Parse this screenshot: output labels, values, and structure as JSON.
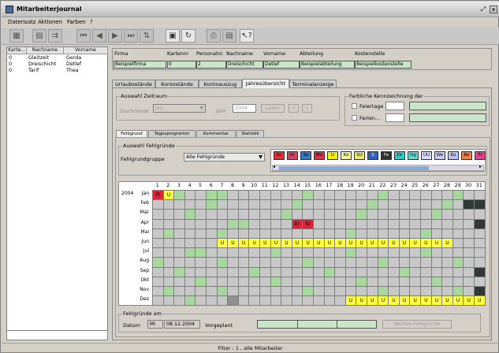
{
  "app": {
    "title": "Mitarbeiterjournal"
  },
  "menu": [
    "Datensatz",
    "Aktionen",
    "Farben",
    "?"
  ],
  "toolbar": {
    "icons": [
      "table-icon",
      "save-icon",
      "copy-icon",
      "first-record-icon",
      "previous-record-icon",
      "next-record-icon",
      "last-record-icon",
      "sort-icon",
      "disk-icon",
      "undo-icon",
      "print-icon",
      "print-preview-icon",
      "help-icon"
    ]
  },
  "left": {
    "headers": [
      "Karte...",
      "Nachname",
      "Vorname"
    ],
    "rows": [
      [
        "0",
        "Gleitzeit",
        "Gerda"
      ],
      [
        "0",
        "Dreischicht",
        "Detlef"
      ],
      [
        "0",
        "Tarif",
        "Thea"
      ]
    ]
  },
  "form": {
    "headers": [
      "Firma",
      "Kartennr",
      "Personalnr.",
      "Nachname",
      "Vorname",
      "Abteilung",
      "Kostenstelle"
    ],
    "values": [
      "Beispielfirma",
      "0",
      "2",
      "Dreischicht",
      "Detlef",
      "Beispielabteilung",
      "Beispielkostenstelle"
    ]
  },
  "tabs": [
    "Urlaubsstände",
    "Kontostände",
    "Kontoauszug",
    "Jahresübersicht",
    "Terminalanzeige"
  ],
  "zeitraum": {
    "legend": "Auswahl Zeitraum",
    "startmonat_label": "Startmonat",
    "startmonat_value": "Jan",
    "jahr_label": "Jahr",
    "jahr_value": "2004",
    "laden": "Laden",
    "prev": "<",
    "next": ">"
  },
  "farblich": {
    "legend": "Farbliche Kennzeichnung der",
    "feiertage": "Feiertage",
    "ferien": "Ferien..."
  },
  "subtabs": [
    "Fehlgrund",
    "Tagesprogramm",
    "Kommentar",
    "Statistik"
  ],
  "fehlgruende": {
    "legend": "Auswahl Fehlgründe",
    "gruppe_label": "Fehlgrundgruppe",
    "gruppe_value": "Alle Fehlgründe",
    "codes": [
      {
        "t": "Kr",
        "bg": "#e0303a",
        "fg": "#000"
      },
      {
        "t": "Kr",
        "bg": "#d84060",
        "fg": "#000"
      },
      {
        "t": "Se",
        "bg": "#3878c8",
        "fg": "#000"
      },
      {
        "t": "Mü",
        "bg": "#e03048",
        "fg": "#000"
      },
      {
        "t": "U",
        "bg": "#f0f000",
        "fg": "#000"
      },
      {
        "t": "Ko",
        "bg": "#f4f4a0",
        "fg": "#000"
      },
      {
        "t": "SU",
        "bg": "#e8e870",
        "fg": "#000"
      },
      {
        "t": "S",
        "bg": "#3060c0",
        "fg": "#fff"
      },
      {
        "t": "Fe",
        "bg": "#303030",
        "fg": "#fff"
      },
      {
        "t": "Dr",
        "bg": "#30c8c8",
        "fg": "#000"
      },
      {
        "t": "Dg",
        "bg": "#60d8d8",
        "fg": "#000"
      },
      {
        "t": "UU",
        "bg": "#d8d8f8",
        "fg": "#000"
      },
      {
        "t": "We",
        "bg": "#c8c8f8",
        "fg": "#000"
      },
      {
        "t": "Ko",
        "bg": "#c0c0f8",
        "fg": "#000"
      },
      {
        "t": "Be",
        "bg": "#f08040",
        "fg": "#000"
      },
      {
        "t": "Ft",
        "bg": "#e84090",
        "fg": "#000"
      }
    ]
  },
  "calendar": {
    "year": "2004",
    "days": [
      "1",
      "2",
      "3",
      "4",
      "5",
      "6",
      "7",
      "8",
      "9",
      "10",
      "11",
      "12",
      "13",
      "14",
      "15",
      "16",
      "17",
      "18",
      "19",
      "20",
      "21",
      "22",
      "23",
      "24",
      "25",
      "26",
      "27",
      "28",
      "29",
      "30",
      "31"
    ],
    "months": [
      "Jan",
      "Feb",
      "Mär",
      "Apr",
      "Mai",
      "Jun",
      "Jul",
      "Aug",
      "Sep",
      "Okt",
      "Nov",
      "Dez"
    ],
    "grid": [
      "FUgwwggwwwwwwwgwwwwwwgwwwwwwgww",
      "wwwwwgwwwwwwwgwwwwwwgwwwwwwgwdd",
      "wwwgwwwwwwwwgwwwwwwgwwwwwwgwwww",
      "wwwwwwwggwwwwKKwwwwwwwwwwwwwwwd",
      "wgwwwwgwwwwwwwwwwwgwwwwwwgwwwww",
      "wwwwwwUUUUUUUUUUUUUUUUUUUUUUwww",
      "wwwggwwwwwwgwwwwwwgwwwwwwgwwwww",
      "gwwwwwgwwwwwwwgwwwwwwgwwwwwwgww",
      "wwgwwwwwwgwwwwwwgwwwwwwgwwwwwwd",
      "wwwwgwwwwwwgwwwwwwwgwwwwwwgwwww",
      "wgwwwwgwwwwwwwgwwwwwwgwwwwwwgwd",
      "wwwgwwwDwwwwwwwwwwUUUUUUUUUUUUU"
    ]
  },
  "bottom": {
    "legend": "Fehlgründe am",
    "datum_label": "Datum",
    "weekday": "Mi",
    "date": "08.12.2004",
    "vorgeplant": "Vorgeplant",
    "weitere": "Weitere Fehlgründe"
  },
  "status": {
    "text": "Filter : 1 , alle Mitarbeiter"
  }
}
